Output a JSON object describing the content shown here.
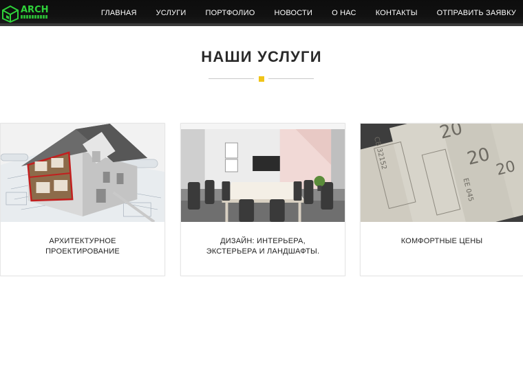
{
  "header": {
    "logo": {
      "text": "ARCH",
      "subtext": "",
      "accent_color": "#2fd23a"
    },
    "nav": [
      {
        "label": "ГЛАВНАЯ"
      },
      {
        "label": "УСЛУГИ"
      },
      {
        "label": "ПОРТФОЛИО"
      },
      {
        "label": "НОВОСТИ"
      },
      {
        "label": "О НАС"
      },
      {
        "label": "КОНТАКТЫ"
      },
      {
        "label": "ОТПРАВИТЬ ЗАЯВКУ"
      }
    ]
  },
  "main": {
    "title": "НАШИ УСЛУГИ",
    "divider_accent_color": "#f0c419",
    "cards": [
      {
        "label": "АРХИТЕКТУРНОЕ\nПРОЕКТИРОВАНИЕ",
        "image": "house-blueprint-image"
      },
      {
        "label": "ДИЗАЙН: ИНТЕРЬЕРА,\nЭКСТЕРЬЕРА И ЛАНДШАФТЫ.",
        "image": "interior-meeting-room-image"
      },
      {
        "label": "КОМФОРТНЫЕ ЦЕНЫ",
        "image": "dollar-bills-image"
      }
    ]
  }
}
